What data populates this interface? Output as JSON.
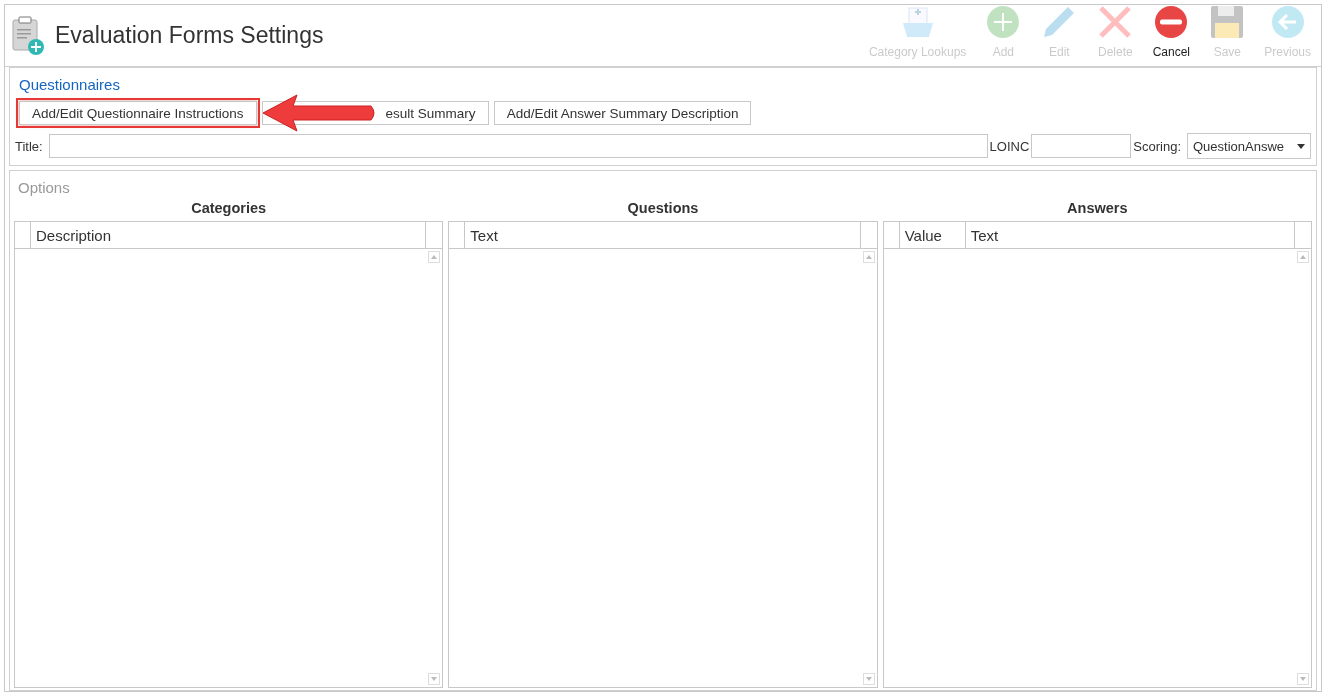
{
  "window": {
    "title": "Evaluation Forms Settings"
  },
  "toolbar": [
    {
      "label": "Category Lookups",
      "kind": "lookups",
      "disabled": true
    },
    {
      "label": "Add",
      "kind": "add",
      "disabled": true
    },
    {
      "label": "Edit",
      "kind": "edit",
      "disabled": true
    },
    {
      "label": "Delete",
      "kind": "delete",
      "disabled": true
    },
    {
      "label": "Cancel",
      "kind": "cancel",
      "disabled": false
    },
    {
      "label": "Save",
      "kind": "save",
      "disabled": true
    },
    {
      "label": "Previous",
      "kind": "previous",
      "disabled": true
    }
  ],
  "questionnaires": {
    "heading": "Questionnaires",
    "buttons": [
      {
        "label": "Add/Edit Questionnaire Instructions",
        "highlighted": true
      },
      {
        "label": "esult Summary",
        "highlighted": false
      },
      {
        "label": "Add/Edit Answer Summary Description",
        "highlighted": false
      }
    ],
    "title_label": "Title:",
    "loinc_label": "LOINC",
    "scoring_label": "Scoring:",
    "scoring_value": "QuestionAnswe"
  },
  "options": {
    "heading": "Options",
    "grids": [
      {
        "title": "Categories",
        "columns": [
          "Description"
        ]
      },
      {
        "title": "Questions",
        "columns": [
          "Text"
        ]
      },
      {
        "title": "Answers",
        "columns": [
          "Value",
          "Text"
        ]
      }
    ]
  }
}
